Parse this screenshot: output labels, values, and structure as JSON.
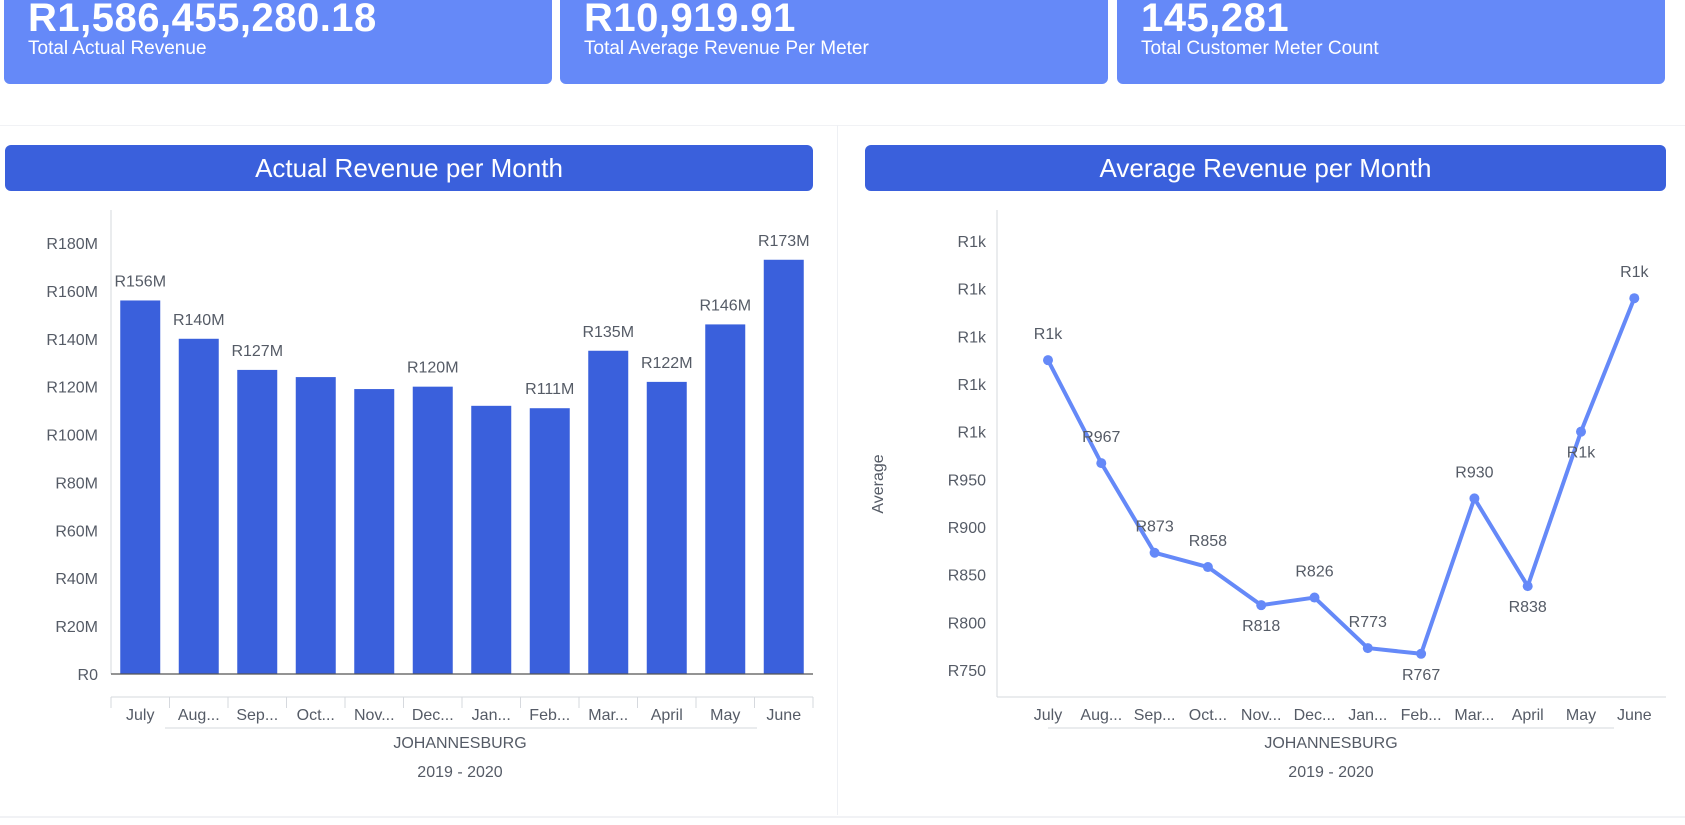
{
  "kpis": [
    {
      "value": "R1,586,455,280.18",
      "label": "Total Actual Revenue"
    },
    {
      "value": "R10,919.91",
      "label": "Total Average Revenue Per Meter"
    },
    {
      "value": "145,281",
      "label": "Total Customer Meter Count"
    }
  ],
  "colors": {
    "kpi_bg": "#6589f8",
    "title_bg": "#3a60dc",
    "bar": "#3a60dc",
    "line": "#6589f8"
  },
  "chart_data": [
    {
      "type": "bar",
      "title": "Actual Revenue per Month",
      "categories": [
        "July",
        "Aug...",
        "Sep...",
        "Oct...",
        "Nov...",
        "Dec...",
        "Jan...",
        "Feb...",
        "Mar...",
        "April",
        "May",
        "June"
      ],
      "values": [
        156,
        140,
        127,
        124,
        119,
        120,
        112,
        111,
        135,
        122,
        146,
        173
      ],
      "value_unit": "R millions",
      "data_labels": [
        "R156M",
        "R140M",
        "R127M",
        "",
        "",
        "R120M",
        "",
        "R111M",
        "R135M",
        "R122M",
        "R146M",
        "R173M"
      ],
      "y_ticks": [
        "R0",
        "R20M",
        "R40M",
        "R60M",
        "R80M",
        "R100M",
        "R120M",
        "R140M",
        "R160M",
        "R180M"
      ],
      "ylim": [
        0,
        180
      ],
      "xlabel_groups": [
        "JOHANNESBURG",
        "2019 - 2020"
      ],
      "ylabel": ""
    },
    {
      "type": "line",
      "title": "Average Revenue per Month",
      "categories": [
        "July",
        "Aug...",
        "Sep...",
        "Oct...",
        "Nov...",
        "Dec...",
        "Jan...",
        "Feb...",
        "Mar...",
        "April",
        "May",
        "June"
      ],
      "values": [
        1075,
        967,
        873,
        858,
        818,
        826,
        773,
        767,
        930,
        838,
        1000,
        1140
      ],
      "data_labels": [
        "R1k",
        "R967",
        "R873",
        "R858",
        "R818",
        "R826",
        "R773",
        "R767",
        "R930",
        "R838",
        "R1k",
        "R1k"
      ],
      "label_position": [
        "above",
        "above",
        "above",
        "above",
        "below",
        "above",
        "above",
        "below",
        "above",
        "below",
        "below",
        "above"
      ],
      "y_ticks": [
        {
          "value": 750,
          "label": "R750"
        },
        {
          "value": 800,
          "label": "R800"
        },
        {
          "value": 850,
          "label": "R850"
        },
        {
          "value": 900,
          "label": "R900"
        },
        {
          "value": 950,
          "label": "R950"
        },
        {
          "value": 1000,
          "label": "R1k"
        },
        {
          "value": 1050,
          "label": "R1k"
        },
        {
          "value": 1100,
          "label": "R1k"
        },
        {
          "value": 1150,
          "label": "R1k"
        },
        {
          "value": 1200,
          "label": "R1k"
        }
      ],
      "ylim": [
        750,
        1200
      ],
      "ylabel": "Average",
      "xlabel_groups": [
        "JOHANNESBURG",
        "2019 - 2020"
      ]
    }
  ]
}
